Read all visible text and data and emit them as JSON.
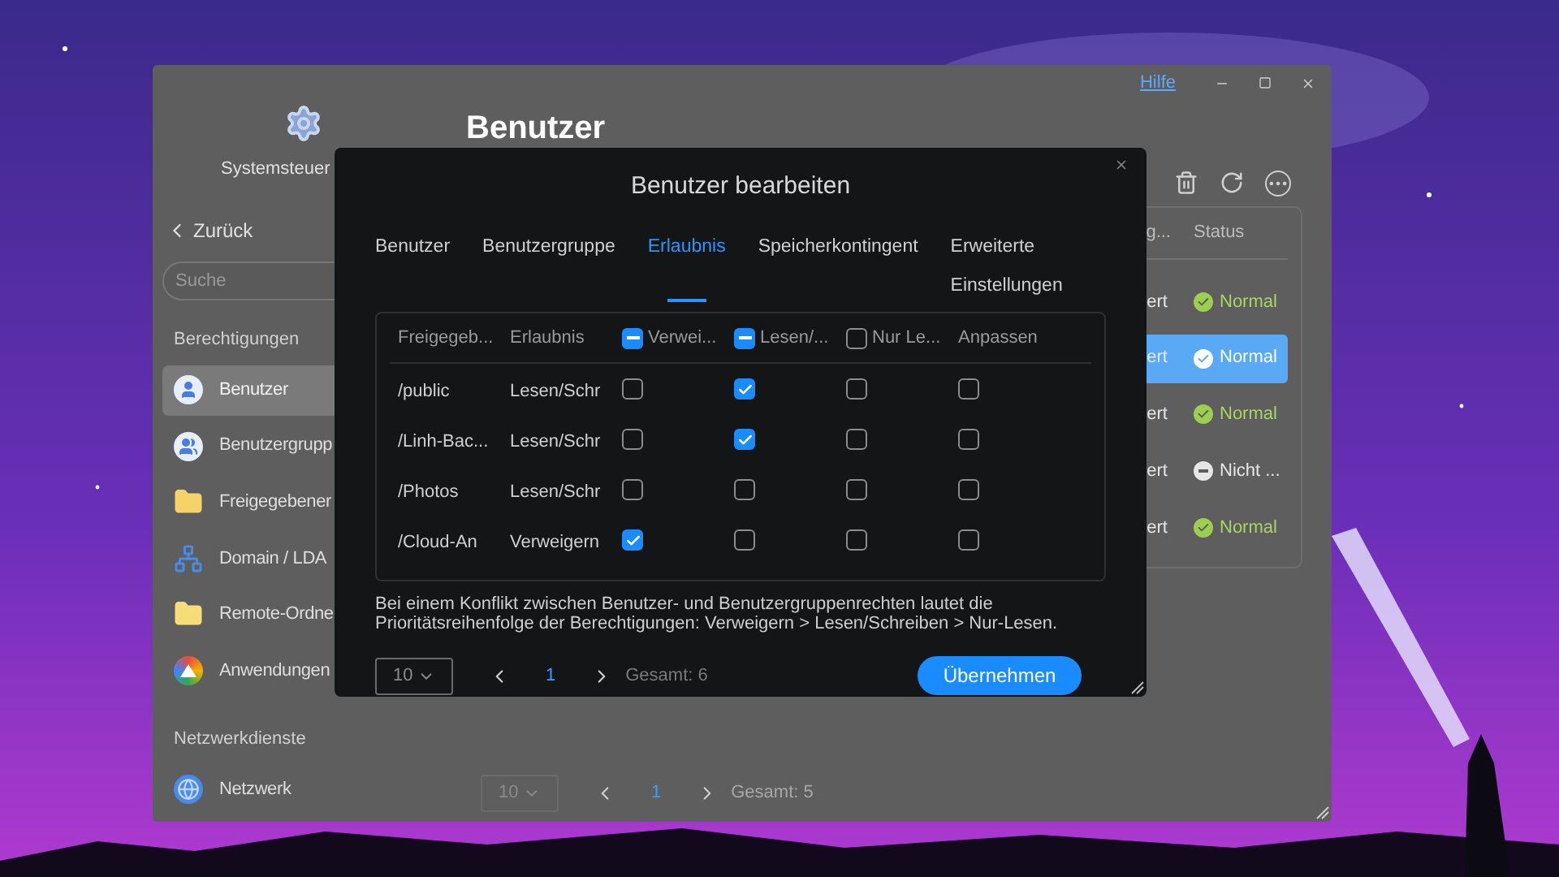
{
  "window": {
    "help_link": "Hilfe",
    "app_title": "Systemsteuer",
    "back": "Zurück",
    "search": {
      "placeholder": "Suche"
    }
  },
  "sidebar": {
    "sections": [
      {
        "title": "Berechtigungen",
        "items": [
          {
            "label": "Benutzer",
            "kind": "user",
            "selected": true
          },
          {
            "label": "Benutzergrupp",
            "kind": "group",
            "selected": false
          },
          {
            "label": "Freigegebener",
            "kind": "folder",
            "selected": false
          },
          {
            "label": "Domain / LDA",
            "kind": "domain",
            "selected": false
          },
          {
            "label": "Remote-Ordne",
            "kind": "remote",
            "selected": false
          },
          {
            "label": "Anwendungen",
            "kind": "apps",
            "selected": false
          }
        ]
      },
      {
        "title": "Netzwerkdienste",
        "items": [
          {
            "label": "Netzwerk",
            "kind": "globe",
            "selected": false
          }
        ]
      }
    ]
  },
  "page": {
    "title": "Benutzer",
    "table": {
      "columns": [
        "g...",
        "Status"
      ],
      "rows": [
        {
          "column_1": "ert",
          "status": "Normal",
          "kind": "ok",
          "selected": false
        },
        {
          "column_1": "ert",
          "status": "Normal",
          "kind": "ok",
          "selected": true
        },
        {
          "column_1": "ert",
          "status": "Normal",
          "kind": "ok",
          "selected": false
        },
        {
          "column_1": "ert",
          "status": "Nicht ...",
          "kind": "off",
          "selected": false
        },
        {
          "column_1": "ert",
          "status": "Normal",
          "kind": "ok",
          "selected": false
        }
      ]
    },
    "pagination": {
      "page_size": "10",
      "page": "1",
      "total": "Gesamt: 5"
    }
  },
  "dialog": {
    "title": "Benutzer bearbeiten",
    "tabs": [
      {
        "label": "Benutzer",
        "selected": false
      },
      {
        "label": "Benutzergruppe",
        "selected": false
      },
      {
        "label": "Erlaubnis",
        "selected": true
      },
      {
        "label": "Speicherkontingent",
        "selected": false
      },
      {
        "label": "Erweiterte Einstellungen",
        "selected": false
      }
    ],
    "table": {
      "columns": [
        {
          "label": "Freigegeb...",
          "kind": "text"
        },
        {
          "label": "Erlaubnis",
          "kind": "text"
        },
        {
          "label": "Verwei...",
          "kind": "checkbox",
          "indeterminate": true
        },
        {
          "label": "Lesen/...",
          "kind": "checkbox",
          "indeterminate": true
        },
        {
          "label": "Nur Le...",
          "kind": "checkbox",
          "indeterminate": false
        },
        {
          "label": "Anpassen",
          "kind": "text"
        }
      ],
      "rows": [
        {
          "share": "/public",
          "permission": "Lesen/Schr",
          "checks": [
            false,
            true,
            false,
            false
          ]
        },
        {
          "share": "/Linh-Bac...",
          "permission": "Lesen/Schr",
          "checks": [
            false,
            true,
            false,
            false
          ]
        },
        {
          "share": "/Photos",
          "permission": "Lesen/Schr",
          "checks": [
            false,
            false,
            false,
            false
          ]
        },
        {
          "share": "/Cloud-An",
          "permission": "Verweigern",
          "checks": [
            true,
            false,
            false,
            false
          ]
        }
      ]
    },
    "note": "Bei einem Konflikt zwischen Benutzer- und Benutzergruppenrechten lautet die Prioritätsreihenfolge der Berechtigungen: Verweigern > Lesen/Schreiben > Nur-Lesen.",
    "pagination": {
      "page_size": "10",
      "page": "1",
      "total": "Gesamt: 6"
    },
    "apply_button": "Übernehmen"
  }
}
